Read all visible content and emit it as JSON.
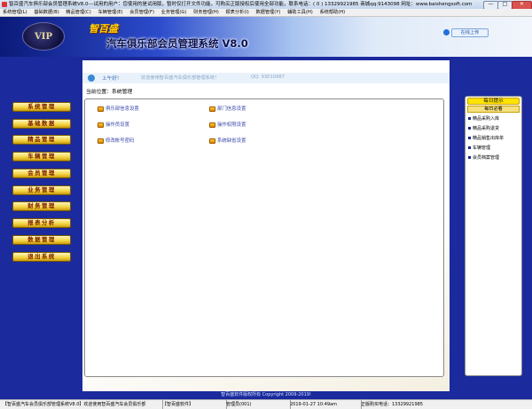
{
  "window": {
    "title": "智百盛汽车俱乐部会员管理系统V8.0---试用的用户：您使用的是试用版，暂时仅打开文件功能，可购买正版授权后使用全部功能，联系电话：( 0 ) 13329921985  商城qq:9143098  网址：www.baishengsoft.com",
    "minimize": "—",
    "maximize": "□",
    "close": "✕"
  },
  "menu": [
    "系统管理(L)",
    "基础数据(B)",
    "精品管理(C)",
    "车辆管理(E)",
    "会员管理(F)",
    "业务管理(G)",
    "财务管理(H)",
    "报表分析(I)",
    "数据管理(Y)",
    "辅助工具(H)",
    "系统帮助(H)"
  ],
  "header": {
    "logo_text": "VIP",
    "brand_name": "智百盛",
    "system_name": "汽车俱乐部会员管理系统 V8.0",
    "upload_button": "在线上传"
  },
  "nav": [
    "系统管理",
    "基础数据",
    "精品管理",
    "车辆管理",
    "会员管理",
    "业务管理",
    "财务管理",
    "报表分析",
    "数据管理",
    "退出系统"
  ],
  "welcome": {
    "user": "上午好！",
    "message": "欢迎使用智百盛汽车俱乐部管理系统！",
    "qq": "QQ: 93010987"
  },
  "location": "当前位置：系统管理",
  "items": [
    "俱乐部信息设置",
    "部门信息设置",
    "操作员设置",
    "操作权限设置",
    "修改帐号密码",
    "系统缺省设置"
  ],
  "tips": {
    "title": "每日提示",
    "subtitle": "每日必看",
    "items": [
      "精品采购入库",
      "精品采购退货",
      "精品销售出库单",
      "车辆管理",
      "会员档案管理"
    ]
  },
  "copyright": "智百盛软件版权所有 Copyright 2009-2019!",
  "status": [
    "【智百盛汽车会员俱乐部管理系统V8.0】欢迎使用智百盛汽车会员俱乐部",
    "【智百盛软件】",
    "管理员(001)",
    "2019-01-27 10:49am",
    "正版购买电话：13329921985"
  ]
}
